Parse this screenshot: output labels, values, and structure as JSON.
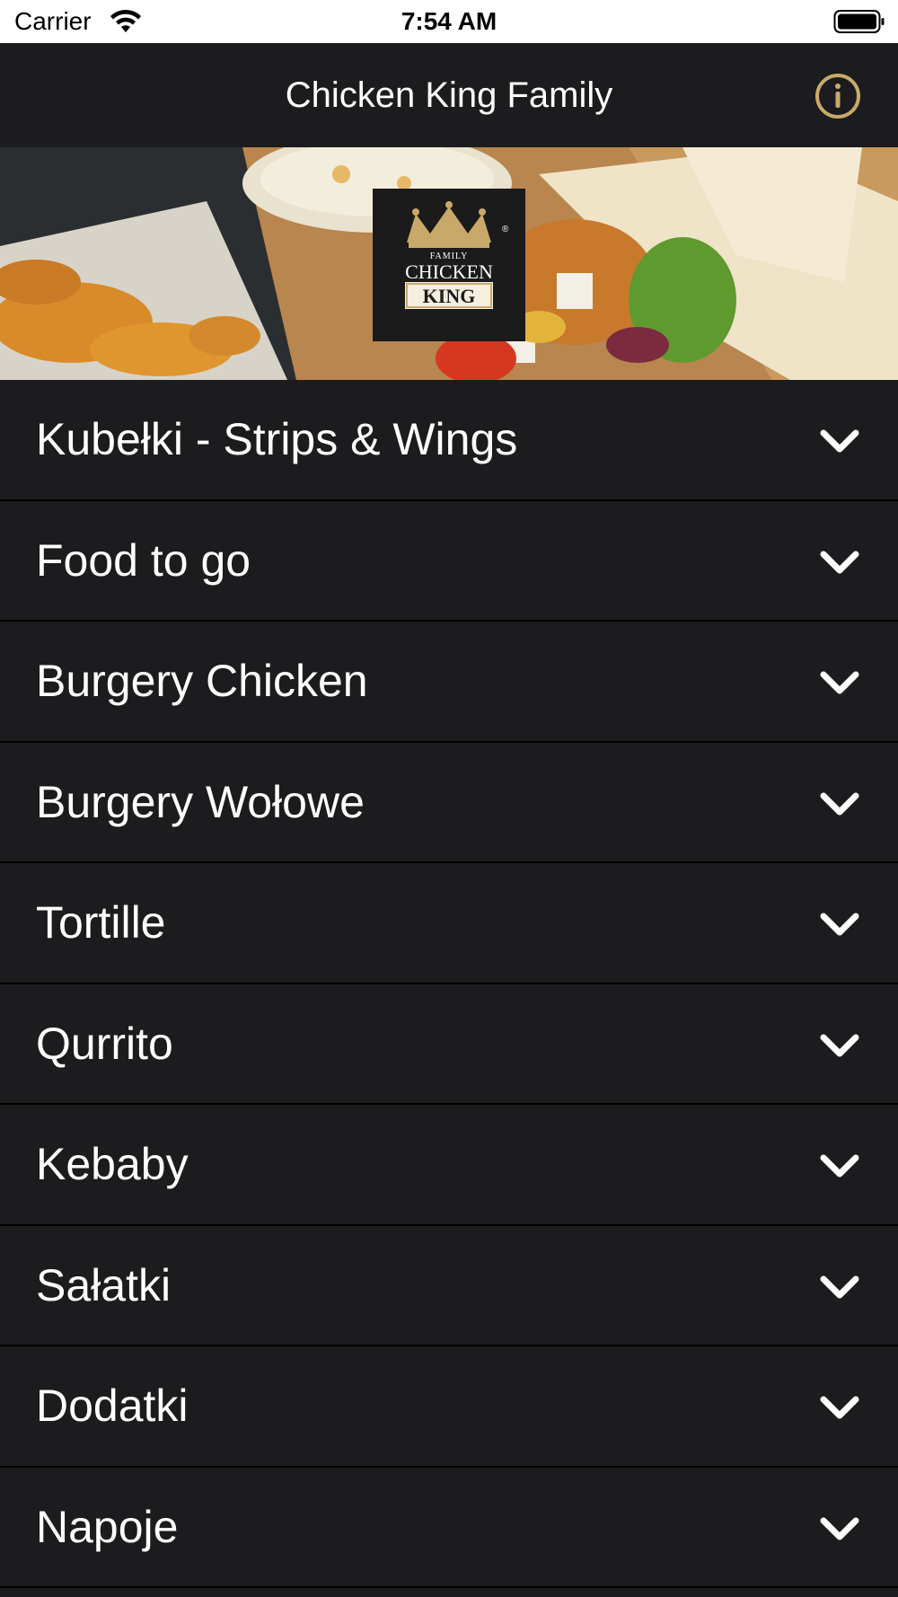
{
  "status_bar": {
    "carrier": "Carrier",
    "time": "7:54 AM",
    "wifi_icon": "wifi-icon",
    "battery_icon": "battery-full-icon"
  },
  "nav": {
    "title": "Chicken King Family",
    "info_icon": "info-circle-icon",
    "accent_color": "#c9a96a"
  },
  "banner": {
    "logo_text": {
      "family": "FAMILY",
      "chicken": "CHICKEN",
      "king": "KING",
      "registered": "®"
    }
  },
  "categories": [
    {
      "label": "Kubełki - Strips & Wings"
    },
    {
      "label": "Food to go"
    },
    {
      "label": "Burgery Chicken"
    },
    {
      "label": "Burgery Wołowe"
    },
    {
      "label": "Tortille"
    },
    {
      "label": "Qurrito"
    },
    {
      "label": "Kebaby"
    },
    {
      "label": "Sałatki"
    },
    {
      "label": "Dodatki"
    },
    {
      "label": "Napoje"
    }
  ],
  "chevron_icon": "chevron-down-icon"
}
